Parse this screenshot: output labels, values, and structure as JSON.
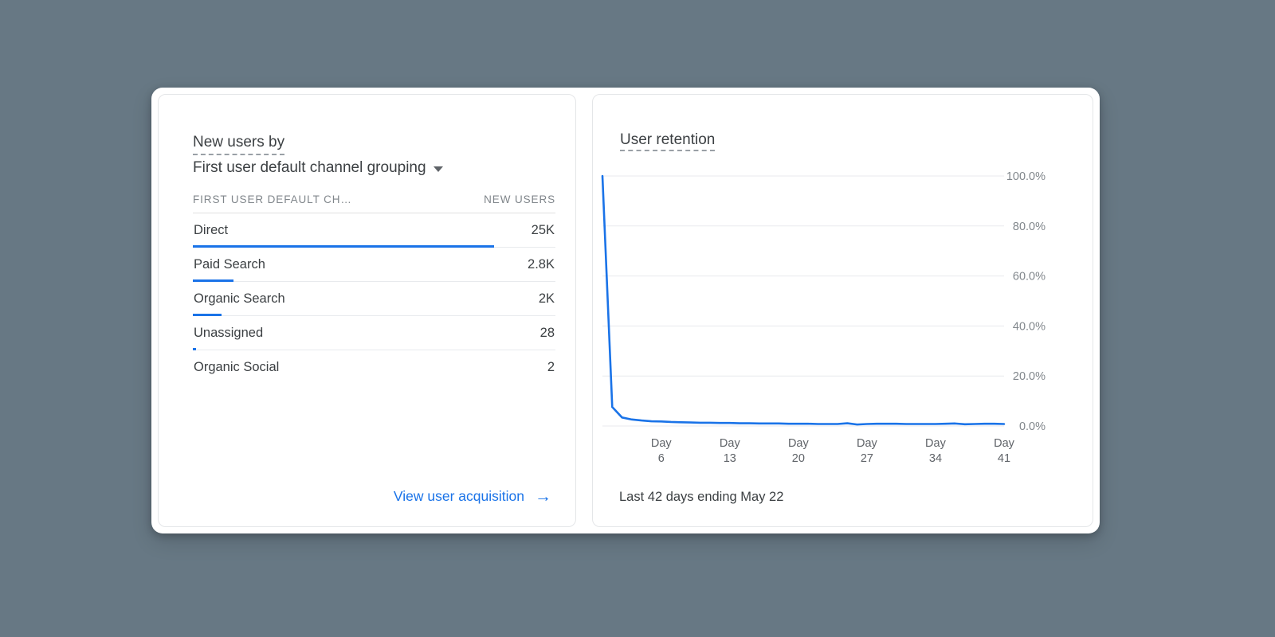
{
  "theme": {
    "page_background": "#677884",
    "card_background": "#ffffff",
    "accent_blue": "#1a73e8",
    "text_primary": "#3c4043",
    "text_secondary": "#80868b",
    "grid_line": "#e8eaed"
  },
  "new_users_card": {
    "title_line1": "New users by",
    "title_line2": "First user default channel grouping",
    "dropdown_icon": "caret-down-icon",
    "columns": {
      "dimension": "FIRST USER DEFAULT CH…",
      "metric": "NEW USERS"
    },
    "rows": [
      {
        "label": "Direct",
        "value": "25K",
        "bar_percent": 83.0
      },
      {
        "label": "Paid Search",
        "value": "2.8K",
        "bar_percent": 11.2
      },
      {
        "label": "Organic Search",
        "value": "2K",
        "bar_percent": 8.0
      },
      {
        "label": "Unassigned",
        "value": "28",
        "bar_percent": 0.9
      },
      {
        "label": "Organic Social",
        "value": "2",
        "bar_percent": 0.0
      }
    ],
    "footer_link": {
      "label": "View user acquisition",
      "icon": "arrow-right-icon",
      "glyph": "→"
    }
  },
  "retention_card": {
    "title": "User retention",
    "footer": "Last 42 days ending May 22"
  },
  "chart_data": {
    "type": "line",
    "title": "User retention",
    "xlabel": "",
    "ylabel": "",
    "ylim": [
      0,
      100
    ],
    "yticks": [
      0,
      20,
      40,
      60,
      80,
      100
    ],
    "ytick_labels": [
      "0.0%",
      "20.0%",
      "40.0%",
      "60.0%",
      "80.0%",
      "100.0%"
    ],
    "grid": true,
    "legend": "none",
    "xtick_positions": [
      6,
      13,
      20,
      27,
      34,
      41
    ],
    "xtick_labels": [
      [
        "Day",
        "6"
      ],
      [
        "Day",
        "13"
      ],
      [
        "Day",
        "20"
      ],
      [
        "Day",
        "27"
      ],
      [
        "Day",
        "34"
      ],
      [
        "Day",
        "41"
      ]
    ],
    "x": [
      0,
      1,
      2,
      3,
      4,
      5,
      6,
      7,
      8,
      9,
      10,
      11,
      12,
      13,
      14,
      15,
      16,
      17,
      18,
      19,
      20,
      21,
      22,
      23,
      24,
      25,
      26,
      27,
      28,
      29,
      30,
      31,
      32,
      33,
      34,
      35,
      36,
      37,
      38,
      39,
      40,
      41
    ],
    "series": [
      {
        "name": "User retention",
        "color": "#1a73e8",
        "values": [
          100.0,
          7.6,
          3.4,
          2.6,
          2.2,
          1.9,
          1.8,
          1.6,
          1.5,
          1.4,
          1.3,
          1.3,
          1.2,
          1.2,
          1.1,
          1.1,
          1.0,
          1.0,
          1.0,
          0.9,
          0.9,
          0.9,
          0.8,
          0.8,
          0.8,
          1.1,
          0.6,
          0.8,
          0.9,
          0.9,
          0.9,
          0.8,
          0.8,
          0.8,
          0.8,
          0.9,
          1.0,
          0.7,
          0.8,
          0.9,
          0.9,
          0.8
        ]
      }
    ]
  }
}
